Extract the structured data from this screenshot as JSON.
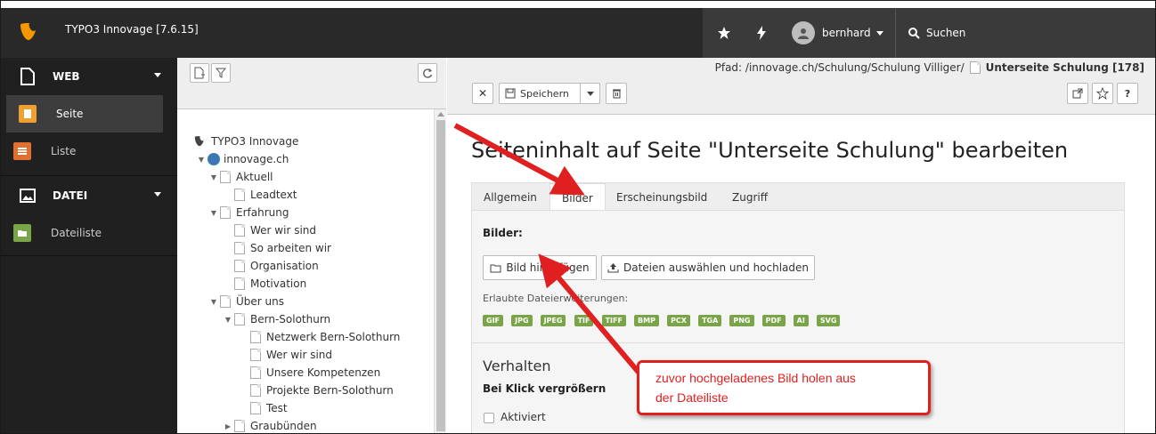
{
  "topbar": {
    "app_title": "TYPO3 Innovage [7.6.15]",
    "user": "bernhard",
    "search_label": "Suchen"
  },
  "modules": {
    "web": {
      "label": "WEB",
      "items": [
        {
          "label": "Seite"
        },
        {
          "label": "Liste"
        }
      ]
    },
    "datei": {
      "label": "DATEI",
      "items": [
        {
          "label": "Dateiliste"
        }
      ]
    },
    "colors": {
      "seite": "#f0a030",
      "liste": "#e07030",
      "dateiliste": "#79a548"
    }
  },
  "tree": {
    "nodes": [
      {
        "label": "TYPO3 Innovage"
      },
      {
        "label": "innovage.ch"
      },
      {
        "label": "Aktuell"
      },
      {
        "label": "Leadtext"
      },
      {
        "label": "Erfahrung"
      },
      {
        "label": "Wer wir sind"
      },
      {
        "label": "So arbeiten wir"
      },
      {
        "label": "Organisation"
      },
      {
        "label": "Motivation"
      },
      {
        "label": "Über uns"
      },
      {
        "label": "Bern-Solothurn"
      },
      {
        "label": "Netzwerk Bern-Solothurn"
      },
      {
        "label": "Wer wir sind"
      },
      {
        "label": "Unsere Kompetenzen"
      },
      {
        "label": "Projekte Bern-Solothurn"
      },
      {
        "label": "Test"
      },
      {
        "label": "Graubünden"
      }
    ]
  },
  "docheader": {
    "path_prefix": "Pfad: /innovage.ch/Schulung/Schulung Villiger/",
    "current_page": "Unterseite Schulung [178]",
    "save_label": "Speichern"
  },
  "main": {
    "heading": "Seiteninhalt auf Seite \"Unterseite Schulung\" bearbeiten",
    "tabs": [
      {
        "label": "Allgemein"
      },
      {
        "label": "Bilder"
      },
      {
        "label": "Erscheinungsbild"
      },
      {
        "label": "Zugriff"
      }
    ],
    "images_label": "Bilder:",
    "add_image_button": "Bild hinzufügen",
    "upload_button": "Dateien auswählen und hochladen",
    "allowed_ext_label": "Erlaubte Dateierweiterungen:",
    "extensions": [
      "GIF",
      "JPG",
      "JPEG",
      "TIF",
      "TIFF",
      "BMP",
      "PCX",
      "TGA",
      "PNG",
      "PDF",
      "AI",
      "SVG"
    ],
    "section_title": "Verhalten",
    "click_enlarge_label": "Bei Klick vergrößern",
    "activated_label": "Aktiviert"
  },
  "annotation": {
    "line1": "zuvor hochgeladenes Bild holen aus",
    "line2": "der Dateiliste",
    "color": "#e02020"
  }
}
